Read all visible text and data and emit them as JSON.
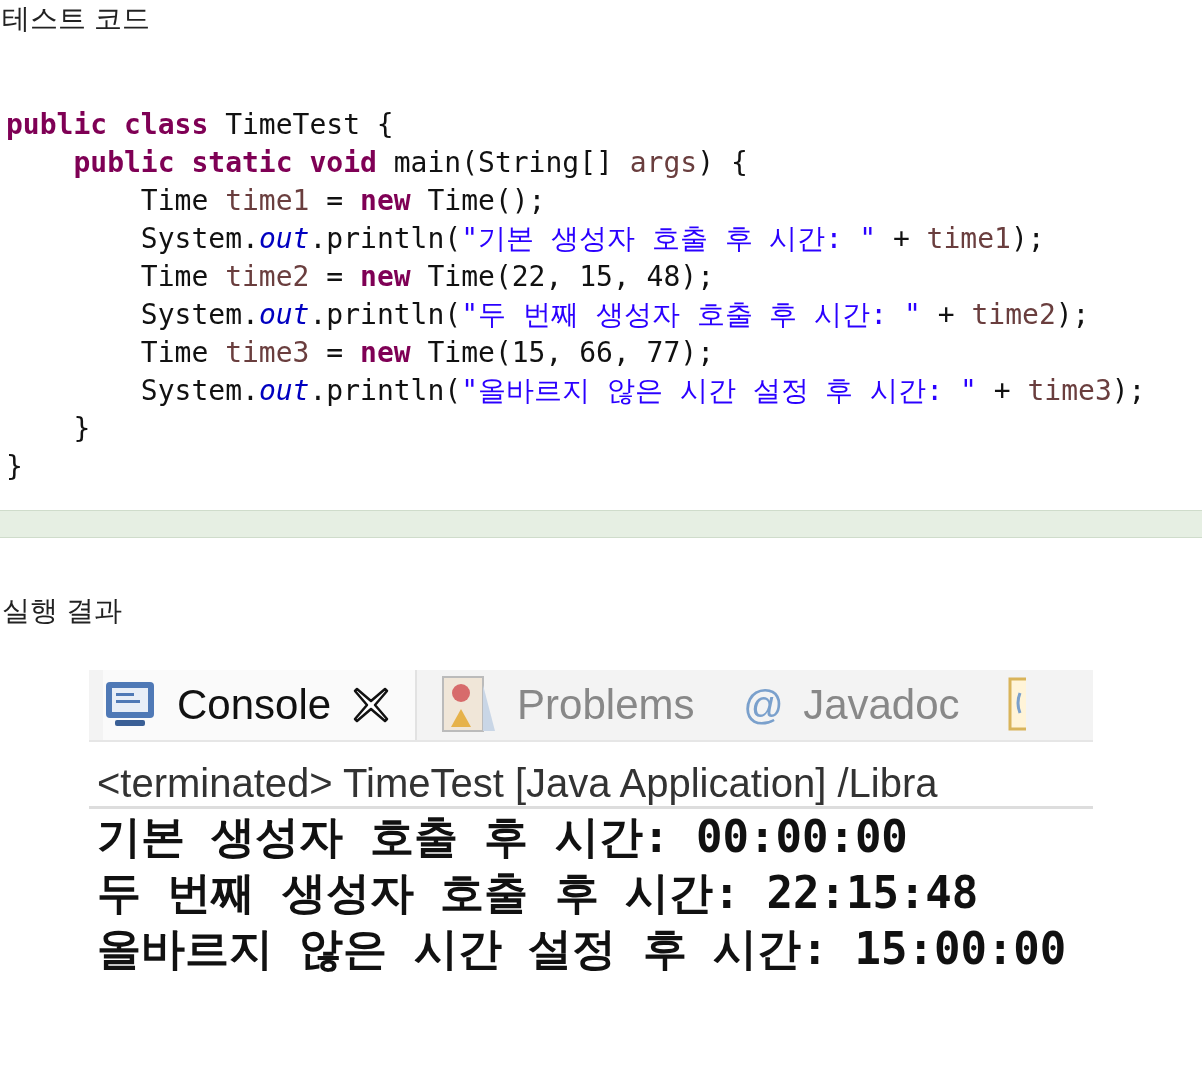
{
  "heading_1": "테스트 코드",
  "code": [
    [
      {
        "kind": "keyword",
        "text": "public class "
      },
      {
        "kind": "plain",
        "text": "TimeTest {"
      }
    ],
    [
      {
        "kind": "keyword",
        "text": "    public static void "
      },
      {
        "kind": "plain",
        "text": "main(String[] "
      },
      {
        "kind": "field",
        "text": "args"
      },
      {
        "kind": "plain",
        "text": ") {"
      }
    ],
    [
      {
        "kind": "plain",
        "text": "        Time "
      },
      {
        "kind": "field",
        "text": "time1"
      },
      {
        "kind": "plain",
        "text": " = "
      },
      {
        "kind": "keyword",
        "text": "new"
      },
      {
        "kind": "plain",
        "text": " Time();"
      }
    ],
    [
      {
        "kind": "plain",
        "text": "        System."
      },
      {
        "kind": "static",
        "text": "out"
      },
      {
        "kind": "plain",
        "text": ".println("
      },
      {
        "kind": "string",
        "text": "\"기본 생성자 호출 후 시간: \""
      },
      {
        "kind": "plain",
        "text": " + "
      },
      {
        "kind": "field",
        "text": "time1"
      },
      {
        "kind": "plain",
        "text": ");"
      }
    ],
    [
      {
        "kind": "plain",
        "text": "        Time "
      },
      {
        "kind": "field",
        "text": "time2"
      },
      {
        "kind": "plain",
        "text": " = "
      },
      {
        "kind": "keyword",
        "text": "new"
      },
      {
        "kind": "plain",
        "text": " Time(22, 15, 48);"
      }
    ],
    [
      {
        "kind": "plain",
        "text": "        System."
      },
      {
        "kind": "static",
        "text": "out"
      },
      {
        "kind": "plain",
        "text": ".println("
      },
      {
        "kind": "string",
        "text": "\"두 번째 생성자 호출 후 시간: \""
      },
      {
        "kind": "plain",
        "text": " + "
      },
      {
        "kind": "field",
        "text": "time2"
      },
      {
        "kind": "plain",
        "text": ");"
      }
    ],
    [
      {
        "kind": "plain",
        "text": "        Time "
      },
      {
        "kind": "field",
        "text": "time3"
      },
      {
        "kind": "plain",
        "text": " = "
      },
      {
        "kind": "keyword",
        "text": "new"
      },
      {
        "kind": "plain",
        "text": " Time(15, 66, 77);"
      }
    ],
    [
      {
        "kind": "plain",
        "text": "        System."
      },
      {
        "kind": "static",
        "text": "out"
      },
      {
        "kind": "plain",
        "text": ".println("
      },
      {
        "kind": "string",
        "text": "\"올바르지 않은 시간 설정 후 시간: \""
      },
      {
        "kind": "plain",
        "text": " + "
      },
      {
        "kind": "field",
        "text": "time3"
      },
      {
        "kind": "plain",
        "text": ");"
      }
    ],
    [
      {
        "kind": "plain",
        "text": "    }"
      }
    ],
    [
      {
        "kind": "plain",
        "text": "}"
      }
    ]
  ],
  "heading_2": "실행 결과",
  "console": {
    "tabs": [
      {
        "kind": "console",
        "label": "Console",
        "selected": true,
        "closable": true
      },
      {
        "kind": "problems",
        "label": "Problems",
        "selected": false
      },
      {
        "kind": "javadoc",
        "symbol": "@",
        "label": "Javadoc",
        "selected": false
      },
      {
        "kind": "partial",
        "selected": false
      }
    ],
    "header": "<terminated> TimeTest [Java Application] /Libra",
    "output": [
      "기본 생성자 호출 후 시간: 00:00:00",
      "두 번째 생성자 호출 후 시간: 22:15:48",
      "올바르지 않은 시간 설정 후 시간: 15:00:00"
    ]
  }
}
